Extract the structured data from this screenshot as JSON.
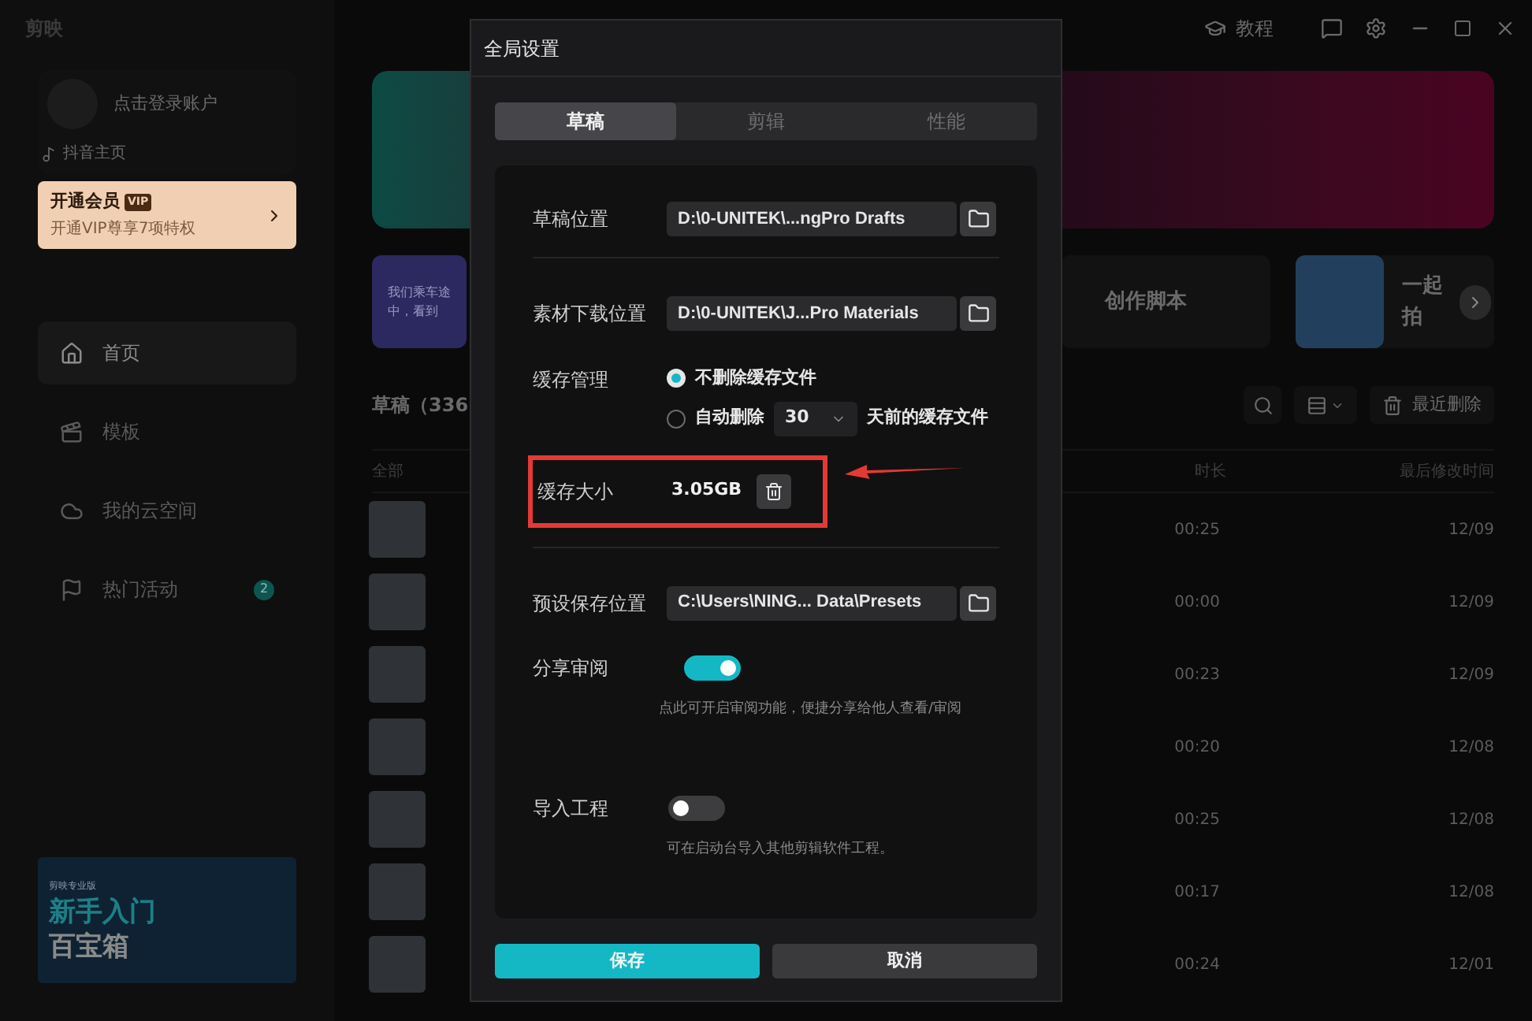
{
  "app": {
    "logo_text": "剪映",
    "tutorial": "教程"
  },
  "sidebar": {
    "login": "点击登录账户",
    "douyin": "抖音主页",
    "vip": {
      "title": "开通会员",
      "badge": "VIP",
      "subtitle": "开通VIP尊享7项特权"
    },
    "nav": [
      {
        "label": "首页",
        "selected": true
      },
      {
        "label": "模板",
        "selected": false
      },
      {
        "label": "我的云空间",
        "selected": false
      },
      {
        "label": "热门活动",
        "selected": false,
        "badge": "2"
      }
    ],
    "promo": {
      "brand": "剪映专业版",
      "line1": "新手入门",
      "line2": "百宝箱"
    }
  },
  "main": {
    "cards": [
      {
        "kind": "purple",
        "text": "我们乘车途中，看到"
      },
      {
        "kind": "script",
        "text": "创作脚本"
      },
      {
        "kind": "together",
        "text": "一起拍"
      }
    ],
    "drafts_title": "草稿（336",
    "recent_delete": "最近删除",
    "columns": [
      "全部",
      "时长",
      "最后修改时间"
    ],
    "rows": [
      {
        "duration": "00:25",
        "date": "12/09"
      },
      {
        "duration": "00:00",
        "date": "12/09"
      },
      {
        "duration": "00:23",
        "date": "12/09"
      },
      {
        "duration": "00:20",
        "date": "12/08"
      },
      {
        "duration": "00:25",
        "date": "12/08"
      },
      {
        "duration": "00:17",
        "date": "12/08"
      },
      {
        "duration": "00:24",
        "date": "12/01"
      }
    ]
  },
  "dialog": {
    "title": "全局设置",
    "tabs": [
      {
        "label": "草稿",
        "selected": true
      },
      {
        "label": "剪辑",
        "selected": false
      },
      {
        "label": "性能",
        "selected": false
      }
    ],
    "draft_location": {
      "label": "草稿位置",
      "value": "D:\\0-UNITEK\\...ngPro Drafts"
    },
    "material_location": {
      "label": "素材下载位置",
      "value": "D:\\0-UNITEK\\J...Pro Materials"
    },
    "cache": {
      "label": "缓存管理",
      "options": [
        {
          "label": "不删除缓存文件",
          "selected": true
        },
        {
          "label": "自动删除",
          "selected": false,
          "days": "30",
          "suffix": "天前的缓存文件"
        }
      ]
    },
    "cache_size": {
      "label": "缓存大小",
      "value": "3.05GB"
    },
    "preset_location": {
      "label": "预设保存位置",
      "value": "C:\\Users\\NING... Data\\Presets"
    },
    "share_review": {
      "label": "分享审阅",
      "on": true,
      "hint": "点此可开启审阅功能，便捷分享给他人查看/审阅"
    },
    "import_project": {
      "label": "导入工程",
      "on": false,
      "hint": "可在启动台导入其他剪辑软件工程。"
    },
    "buttons": [
      {
        "label": "保存",
        "kind": "primary"
      },
      {
        "label": "取消",
        "kind": "secondary"
      }
    ]
  }
}
